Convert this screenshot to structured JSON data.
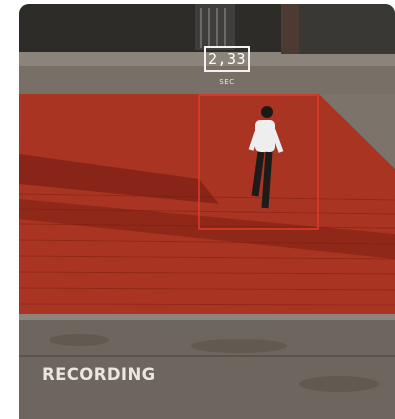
{
  "overlay": {
    "timer_value": "2,33",
    "timer_unit": "SEC",
    "status_label": "RECORDING"
  },
  "colors": {
    "zone_fill": "#b5301c",
    "bbox_stroke": "#e23a28"
  }
}
